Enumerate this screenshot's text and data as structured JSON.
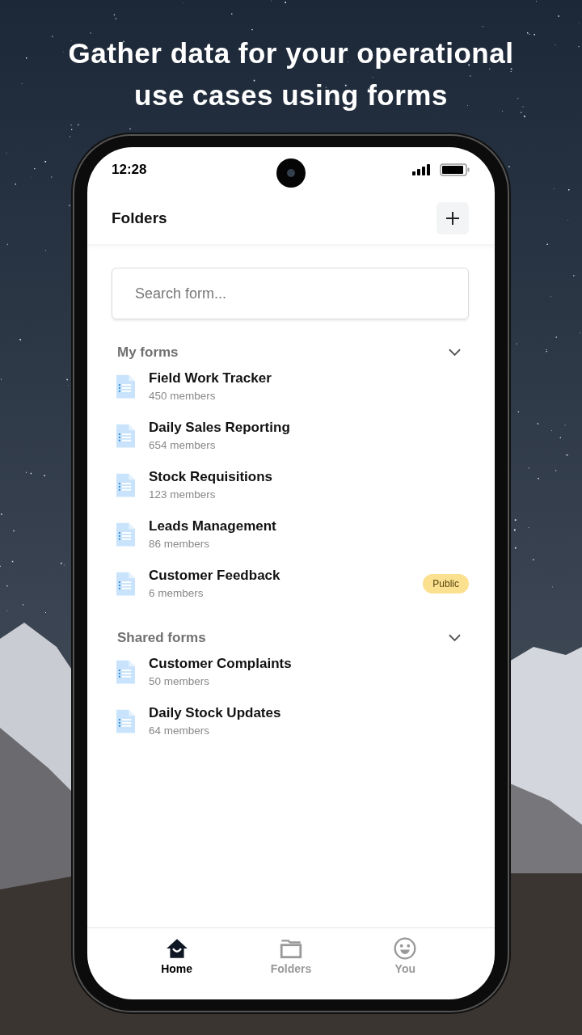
{
  "headline": "Gather data for your operational use cases using forms",
  "status_bar": {
    "time": "12:28"
  },
  "header": {
    "title": "Folders"
  },
  "search": {
    "placeholder": "Search form..."
  },
  "sections": [
    {
      "title": "My forms",
      "expanded": true,
      "forms": [
        {
          "name": "Field Work Tracker",
          "members": "450 members"
        },
        {
          "name": "Daily Sales Reporting",
          "members": "654 members"
        },
        {
          "name": "Stock Requisitions",
          "members": "123 members"
        },
        {
          "name": "Leads Management",
          "members": "86 members"
        },
        {
          "name": "Customer Feedback",
          "members": "6 members",
          "badge": "Public"
        }
      ]
    },
    {
      "title": "Shared forms",
      "expanded": true,
      "forms": [
        {
          "name": "Customer Complaints",
          "members": "50 members"
        },
        {
          "name": "Daily Stock Updates",
          "members": "64 members"
        }
      ]
    }
  ],
  "bottom_nav": [
    {
      "kind": "home",
      "label": "Home",
      "selected": true
    },
    {
      "kind": "folders",
      "label": "Folders",
      "selected": false
    },
    {
      "kind": "you",
      "label": "You",
      "selected": false
    }
  ]
}
